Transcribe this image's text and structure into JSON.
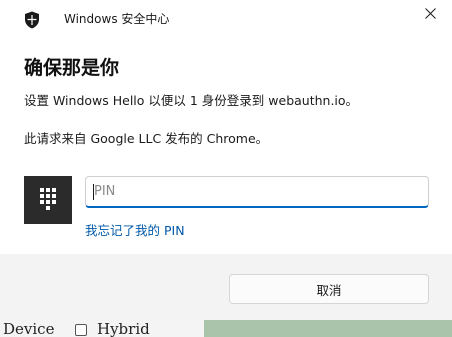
{
  "window": {
    "app_title": "Windows 安全中心",
    "close_glyph": "✕"
  },
  "content": {
    "heading": "确保那是你",
    "line1": "设置 Windows Hello 以便以 1 身份登录到 webauthn.io。",
    "line2": "此请求来自 Google LLC 发布的 Chrome。",
    "pin": {
      "placeholder": "PIN",
      "value": ""
    },
    "forgot_link": "我忘记了我的 PIN"
  },
  "footer": {
    "cancel_label": "取消"
  },
  "background_page": {
    "label_device": "Device",
    "label_hybrid": "Hybrid"
  },
  "icons": {
    "app": "shield-icon",
    "close": "close-icon",
    "keypad": "keypad-icon"
  },
  "colors": {
    "accent": "#0067c0",
    "link": "#0058a8",
    "keypad_tile": "#2b2b2b",
    "footer_bg": "#f3f3f3"
  }
}
